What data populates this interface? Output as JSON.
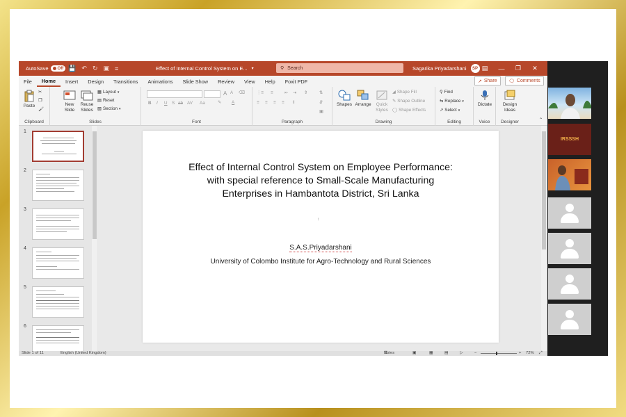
{
  "window": {
    "autosave_label": "AutoSave",
    "autosave_state": "Off",
    "document_title": "Effect of Internal Control System on E...",
    "search_placeholder": "Search",
    "user_name": "Sagarika Priyadarshani",
    "user_initials": "SP"
  },
  "tabs": [
    "File",
    "Home",
    "Insert",
    "Design",
    "Transitions",
    "Animations",
    "Slide Show",
    "Review",
    "View",
    "Help",
    "Foxit PDF"
  ],
  "active_tab": "Home",
  "actions": {
    "share": "Share",
    "comments": "Comments"
  },
  "ribbon": {
    "clipboard": {
      "label": "Clipboard",
      "paste": "Paste"
    },
    "slides": {
      "label": "Slides",
      "new_slide_1": "New",
      "new_slide_2": "Slide",
      "reuse_1": "Reuse",
      "reuse_2": "Slides",
      "layout": "Layout",
      "reset": "Reset",
      "section": "Section"
    },
    "font": {
      "label": "Font",
      "bold": "B",
      "italic": "I",
      "underline": "U",
      "strike": "S",
      "shadow": "ab",
      "spacing": "AV",
      "case": "Aa",
      "grow": "A",
      "shrink": "A"
    },
    "paragraph": {
      "label": "Paragraph"
    },
    "drawing": {
      "label": "Drawing",
      "shapes": "Shapes",
      "arrange": "Arrange",
      "quick_1": "Quick",
      "quick_2": "Styles",
      "fill": "Shape Fill",
      "outline": "Shape Outline",
      "effects": "Shape Effects"
    },
    "editing": {
      "label": "Editing",
      "find": "Find",
      "replace": "Replace",
      "select": "Select"
    },
    "voice": {
      "label": "Voice",
      "dictate": "Dictate"
    },
    "designer": {
      "label": "Designer",
      "ideas_1": "Design",
      "ideas_2": "Ideas"
    }
  },
  "thumbnails": [
    "1",
    "2",
    "3",
    "4",
    "5",
    "6"
  ],
  "slide": {
    "title": "Effect of Internal Control System on Employee Performance: with special reference to Small-Scale Manufacturing Enterprises in Hambantota District, Sri Lanka",
    "author": "S.A.S.Priyadarshani",
    "affiliation": "University of Colombo Institute for Agro-Technology and Rural Sciences"
  },
  "status": {
    "slide_count": "Slide 1 of 11",
    "language": "English (United Kingdom)",
    "notes": "Notes",
    "zoom": "72%"
  },
  "participants": {
    "banner": "IRSSSH"
  }
}
